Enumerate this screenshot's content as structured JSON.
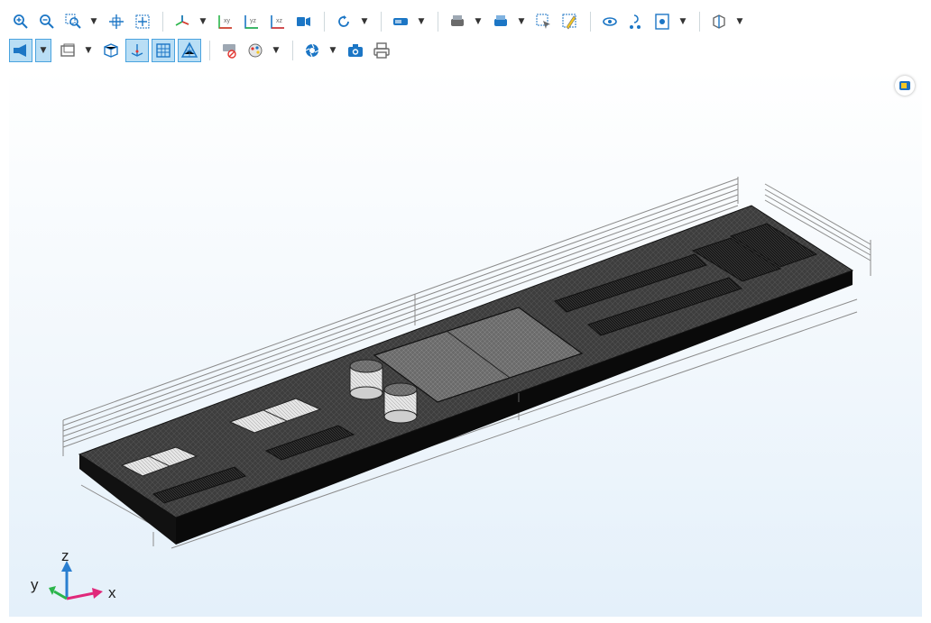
{
  "toolbar": {
    "row1": [
      {
        "name": "zoom-in-icon",
        "dropdown": false
      },
      {
        "name": "zoom-out-icon",
        "dropdown": false
      },
      {
        "name": "zoom-box-icon",
        "dropdown": true
      },
      {
        "name": "zoom-extents-icon",
        "dropdown": false
      },
      {
        "name": "zoom-to-selection-icon",
        "dropdown": false,
        "sep_after": true
      },
      {
        "name": "go-to-default-view-icon",
        "dropdown": true
      },
      {
        "name": "xy-view-icon",
        "dropdown": false
      },
      {
        "name": "yz-view-icon",
        "dropdown": false
      },
      {
        "name": "xz-view-icon",
        "dropdown": false
      },
      {
        "name": "orthographic-projection-icon",
        "dropdown": false,
        "sep_after": true
      },
      {
        "name": "reset-rotation-icon",
        "dropdown": true,
        "sep_after": true
      },
      {
        "name": "wireframe-rendering-icon",
        "dropdown": true,
        "sep_after": true
      },
      {
        "name": "hide-selected-icon",
        "dropdown": true
      },
      {
        "name": "show-hidden-icon",
        "dropdown": true
      },
      {
        "name": "select-box-icon",
        "dropdown": false
      },
      {
        "name": "clear-selection-icon",
        "dropdown": false,
        "sep_after": true
      },
      {
        "name": "transparency-icon",
        "dropdown": false
      },
      {
        "name": "lighting-icon",
        "dropdown": false
      },
      {
        "name": "scene-light-icon",
        "dropdown": true,
        "sep_after": true
      },
      {
        "name": "view-3d-box-icon",
        "dropdown": true
      }
    ],
    "row2": [
      {
        "name": "camera-direction-icon",
        "dropdown": true,
        "active": true
      },
      {
        "name": "show-grid-icon",
        "dropdown": true
      },
      {
        "name": "show-axis-orientation-icon",
        "dropdown": false
      },
      {
        "name": "show-geometry-labels-icon",
        "dropdown": false,
        "active": true
      },
      {
        "name": "show-mesh-icon",
        "dropdown": false,
        "active": true
      },
      {
        "name": "mesh-triangles-icon",
        "dropdown": false,
        "active": true,
        "sep_after": true
      },
      {
        "name": "clear-plot-icon",
        "dropdown": false
      },
      {
        "name": "color-table-icon",
        "dropdown": true,
        "sep_after": true
      },
      {
        "name": "render-settings-icon",
        "dropdown": true
      },
      {
        "name": "image-snapshot-icon",
        "dropdown": false
      },
      {
        "name": "print-icon",
        "dropdown": false
      }
    ]
  },
  "viewport": {
    "badge": "view-indicator-icon",
    "axes": {
      "x": "x",
      "y": "y",
      "z": "z"
    },
    "colors": {
      "x": "#e0287a",
      "y": "#2bb54b",
      "z": "#2a7fd0",
      "board_top": "#3b3b3b",
      "board_side": "#0d0d0d"
    }
  }
}
